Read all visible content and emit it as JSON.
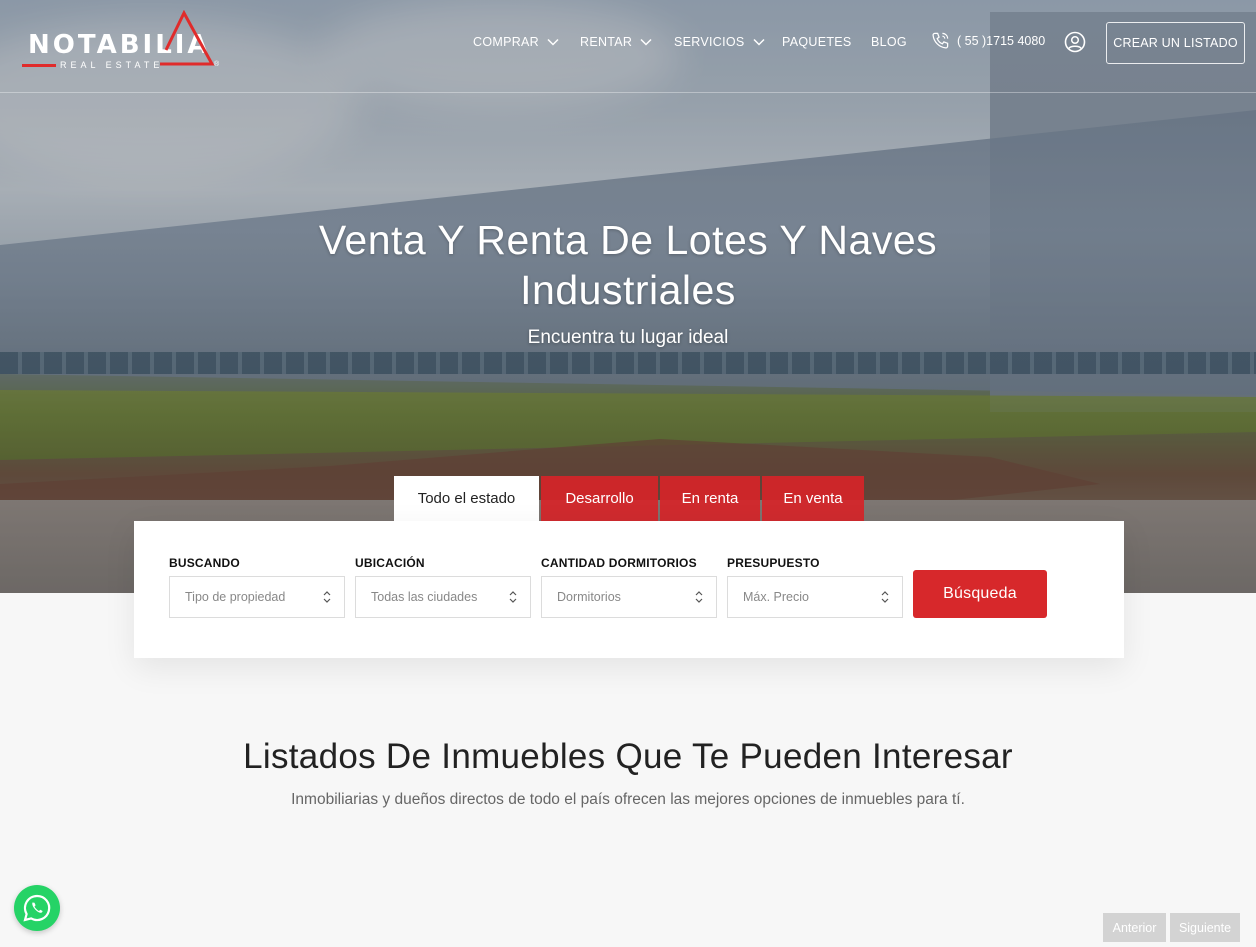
{
  "brand": {
    "name": "NOTABILIA",
    "tagline": "REAL ESTATE",
    "registered": "®",
    "accent": "#d7282b"
  },
  "nav": {
    "items": [
      {
        "label": "COMPRAR",
        "dropdown": true
      },
      {
        "label": "RENTAR",
        "dropdown": true
      },
      {
        "label": "SERVICIOS",
        "dropdown": true
      },
      {
        "label": "PAQUETES",
        "dropdown": false
      },
      {
        "label": "BLOG",
        "dropdown": false
      }
    ],
    "phone": "( 55 )1715 4080",
    "phone_icon": "phone-icon",
    "user_icon": "user-icon",
    "cta": "CREAR UN LISTADO"
  },
  "hero": {
    "title": "Venta Y Renta De Lotes Y Naves Industriales",
    "subtitle": "Encuentra tu lugar ideal"
  },
  "search": {
    "tabs": [
      {
        "label": "Todo el estado",
        "active": true
      },
      {
        "label": "Desarrollo",
        "active": false
      },
      {
        "label": "En renta",
        "active": false
      },
      {
        "label": "En venta",
        "active": false
      }
    ],
    "fields": [
      {
        "label": "BUSCANDO",
        "placeholder": "Tipo de propiedad"
      },
      {
        "label": "UBICACIÓN",
        "placeholder": "Todas las ciudades"
      },
      {
        "label": "CANTIDAD DORMITORIOS",
        "placeholder": "Dormitorios"
      },
      {
        "label": "PRESUPUESTO",
        "placeholder": "Máx. Precio"
      }
    ],
    "button": "Búsqueda"
  },
  "listings": {
    "title": "Listados De Inmuebles Que Te Pueden Interesar",
    "subtitle": "Inmobiliarias y dueños directos de todo el país ofrecen las mejores opciones de inmuebles para tí."
  },
  "pager": {
    "prev": "Anterior",
    "next": "Siguiente"
  },
  "whatsapp_icon": "whatsapp-icon"
}
